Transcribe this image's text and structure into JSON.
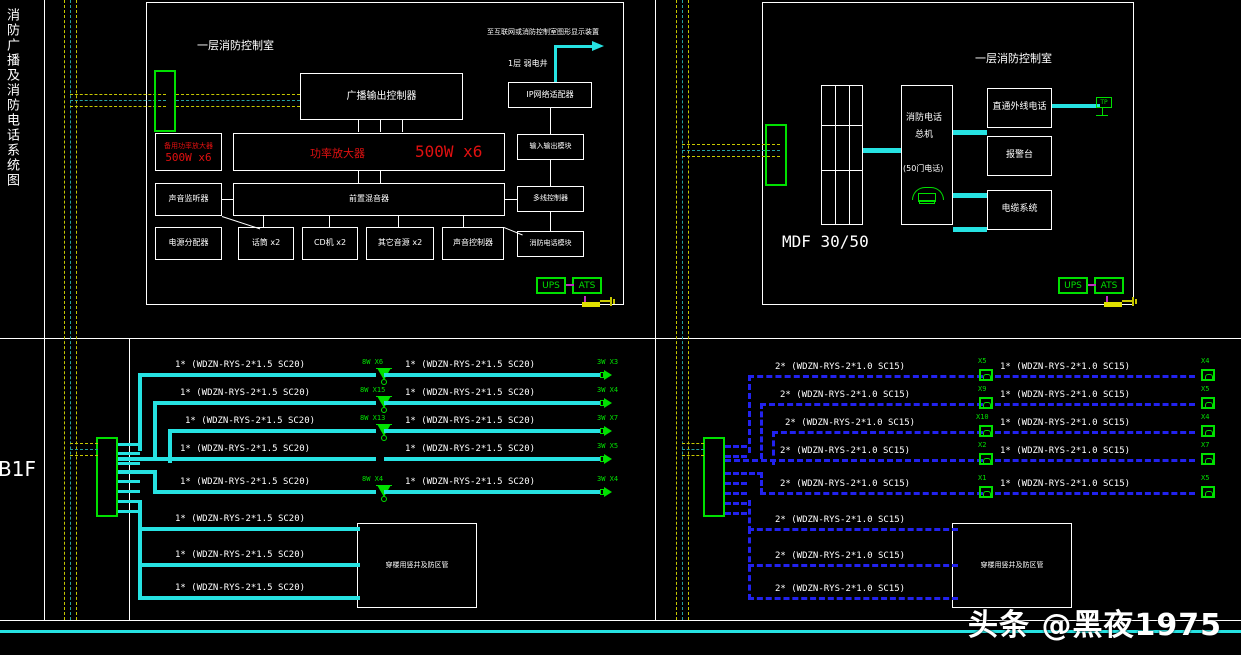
{
  "drawing": {
    "title_vertical": "消防广播及消防电话系统图",
    "floor_labels": [
      "B1F"
    ],
    "watermark": "头条 @黑夜1975"
  },
  "left_panel": {
    "room_label": "一层消防控制室",
    "boxes": {
      "broadcast_controller": "广播输出控制器",
      "power_amplifier_label": "功率放大器",
      "power_amplifier_rating": "500W x6",
      "spare_amp_label": "备用功率放大器",
      "spare_amp_rating": "500W x6",
      "mixer": "前置混音器",
      "monitor_panel": "声音监听器",
      "attenuator": "电源分配器",
      "microphone": "话筒  x2",
      "cd_player": "CD机 x2",
      "other_source": "其它音源   x2",
      "volume_control": "声音控制器",
      "ip_adapter": "IP网络适配器",
      "io_module": "输入输出模块",
      "line_controller": "多线控制器",
      "fire_phone_module": "消防电话模块"
    },
    "network_note": "至互联网或消防控制室图形显示装置",
    "floor_note": "1层 弱电井",
    "power": {
      "ups": "UPS",
      "ats": "ATS"
    }
  },
  "right_panel": {
    "room_label": "一层消防控制室",
    "mdf_label": "MDF 30/50",
    "phone_exchange": {
      "line1": "消防电话",
      "line2": "总机",
      "capacity": "(50门电话)"
    },
    "outputs": [
      "直通外线电话",
      "报警台",
      "电缆系统"
    ],
    "tp_label": "TP",
    "power": {
      "ups": "UPS",
      "ats": "ATS"
    }
  },
  "left_risers": {
    "note_box": "穿楼用竖井及防区管",
    "segments": [
      {
        "cable_left": "1* (WDZN-RYS-2*1.5    SC20)",
        "device_mid": "8W  X6",
        "cable_right": "1* (WDZN-RYS-2*1.5    SC20)",
        "device_right": "3W  X3"
      },
      {
        "cable_left": "1* (WDZN-RYS-2*1.5    SC20)",
        "device_mid": "8W  X15",
        "cable_right": "1* (WDZN-RYS-2*1.5    SC20)",
        "device_right": "3W  X4"
      },
      {
        "cable_left": "1* (WDZN-RYS-2*1.5    SC20)",
        "device_mid": "8W  X13",
        "cable_right": "1* (WDZN-RYS-2*1.5    SC20)",
        "device_right": "3W  X7"
      },
      {
        "cable_left": "1* (WDZN-RYS-2*1.5    SC20)",
        "device_mid": "",
        "cable_right": "1* (WDZN-RYS-2*1.5    SC20)",
        "device_right": "3W  X5"
      },
      {
        "cable_left": "1* (WDZN-RYS-2*1.5    SC20)",
        "device_mid": "8W  X4",
        "cable_right": "1* (WDZN-RYS-2*1.5    SC20)",
        "device_right": "3W  X4"
      },
      {
        "cable_left": "1* (WDZN-RYS-2*1.5    SC20)",
        "device_mid": "",
        "cable_right": "",
        "device_right": ""
      },
      {
        "cable_left": "1* (WDZN-RYS-2*1.5    SC20)",
        "device_mid": "",
        "cable_right": "",
        "device_right": ""
      },
      {
        "cable_left": "1* (WDZN-RYS-2*1.5    SC20)",
        "device_mid": "",
        "cable_right": "",
        "device_right": ""
      }
    ]
  },
  "right_risers": {
    "note_box": "穿楼用竖井及防区管",
    "segments": [
      {
        "cable_left": "2* (WDZN-RYS-2*1.0    SC15)",
        "device_mid": "X5",
        "cable_right": "1* (WDZN-RYS-2*1.0    SC15)",
        "device_right": "X4"
      },
      {
        "cable_left": "2* (WDZN-RYS-2*1.0    SC15)",
        "device_mid": "X9",
        "cable_right": "1* (WDZN-RYS-2*1.0    SC15)",
        "device_right": "X5"
      },
      {
        "cable_left": "2* (WDZN-RYS-2*1.0    SC15)",
        "device_mid": "X10",
        "cable_right": "1* (WDZN-RYS-2*1.0    SC15)",
        "device_right": "X4"
      },
      {
        "cable_left": "2* (WDZN-RYS-2*1.0    SC15)",
        "device_mid": "X2",
        "cable_right": "1* (WDZN-RYS-2*1.0    SC15)",
        "device_right": "X7"
      },
      {
        "cable_left": "2* (WDZN-RYS-2*1.0    SC15)",
        "device_mid": "X1",
        "cable_right": "1* (WDZN-RYS-2*1.0    SC15)",
        "device_right": "X5"
      },
      {
        "cable_left": "2* (WDZN-RYS-2*1.0    SC15)",
        "device_mid": "",
        "cable_right": "",
        "device_right": ""
      },
      {
        "cable_left": "2* (WDZN-RYS-2*1.0    SC15)",
        "device_mid": "",
        "cable_right": "",
        "device_right": ""
      },
      {
        "cable_left": "2* (WDZN-RYS-2*1.0    SC15)",
        "device_mid": "",
        "cable_right": "",
        "device_right": ""
      }
    ]
  },
  "colors": {
    "background": "#000000",
    "line_white": "#ffffff",
    "cable_cyan": "#26e2e2",
    "cable_blue": "#2222ee",
    "device_green": "#00e000",
    "accent_red": "#e01010",
    "dash_yellow": "#c8c800"
  }
}
